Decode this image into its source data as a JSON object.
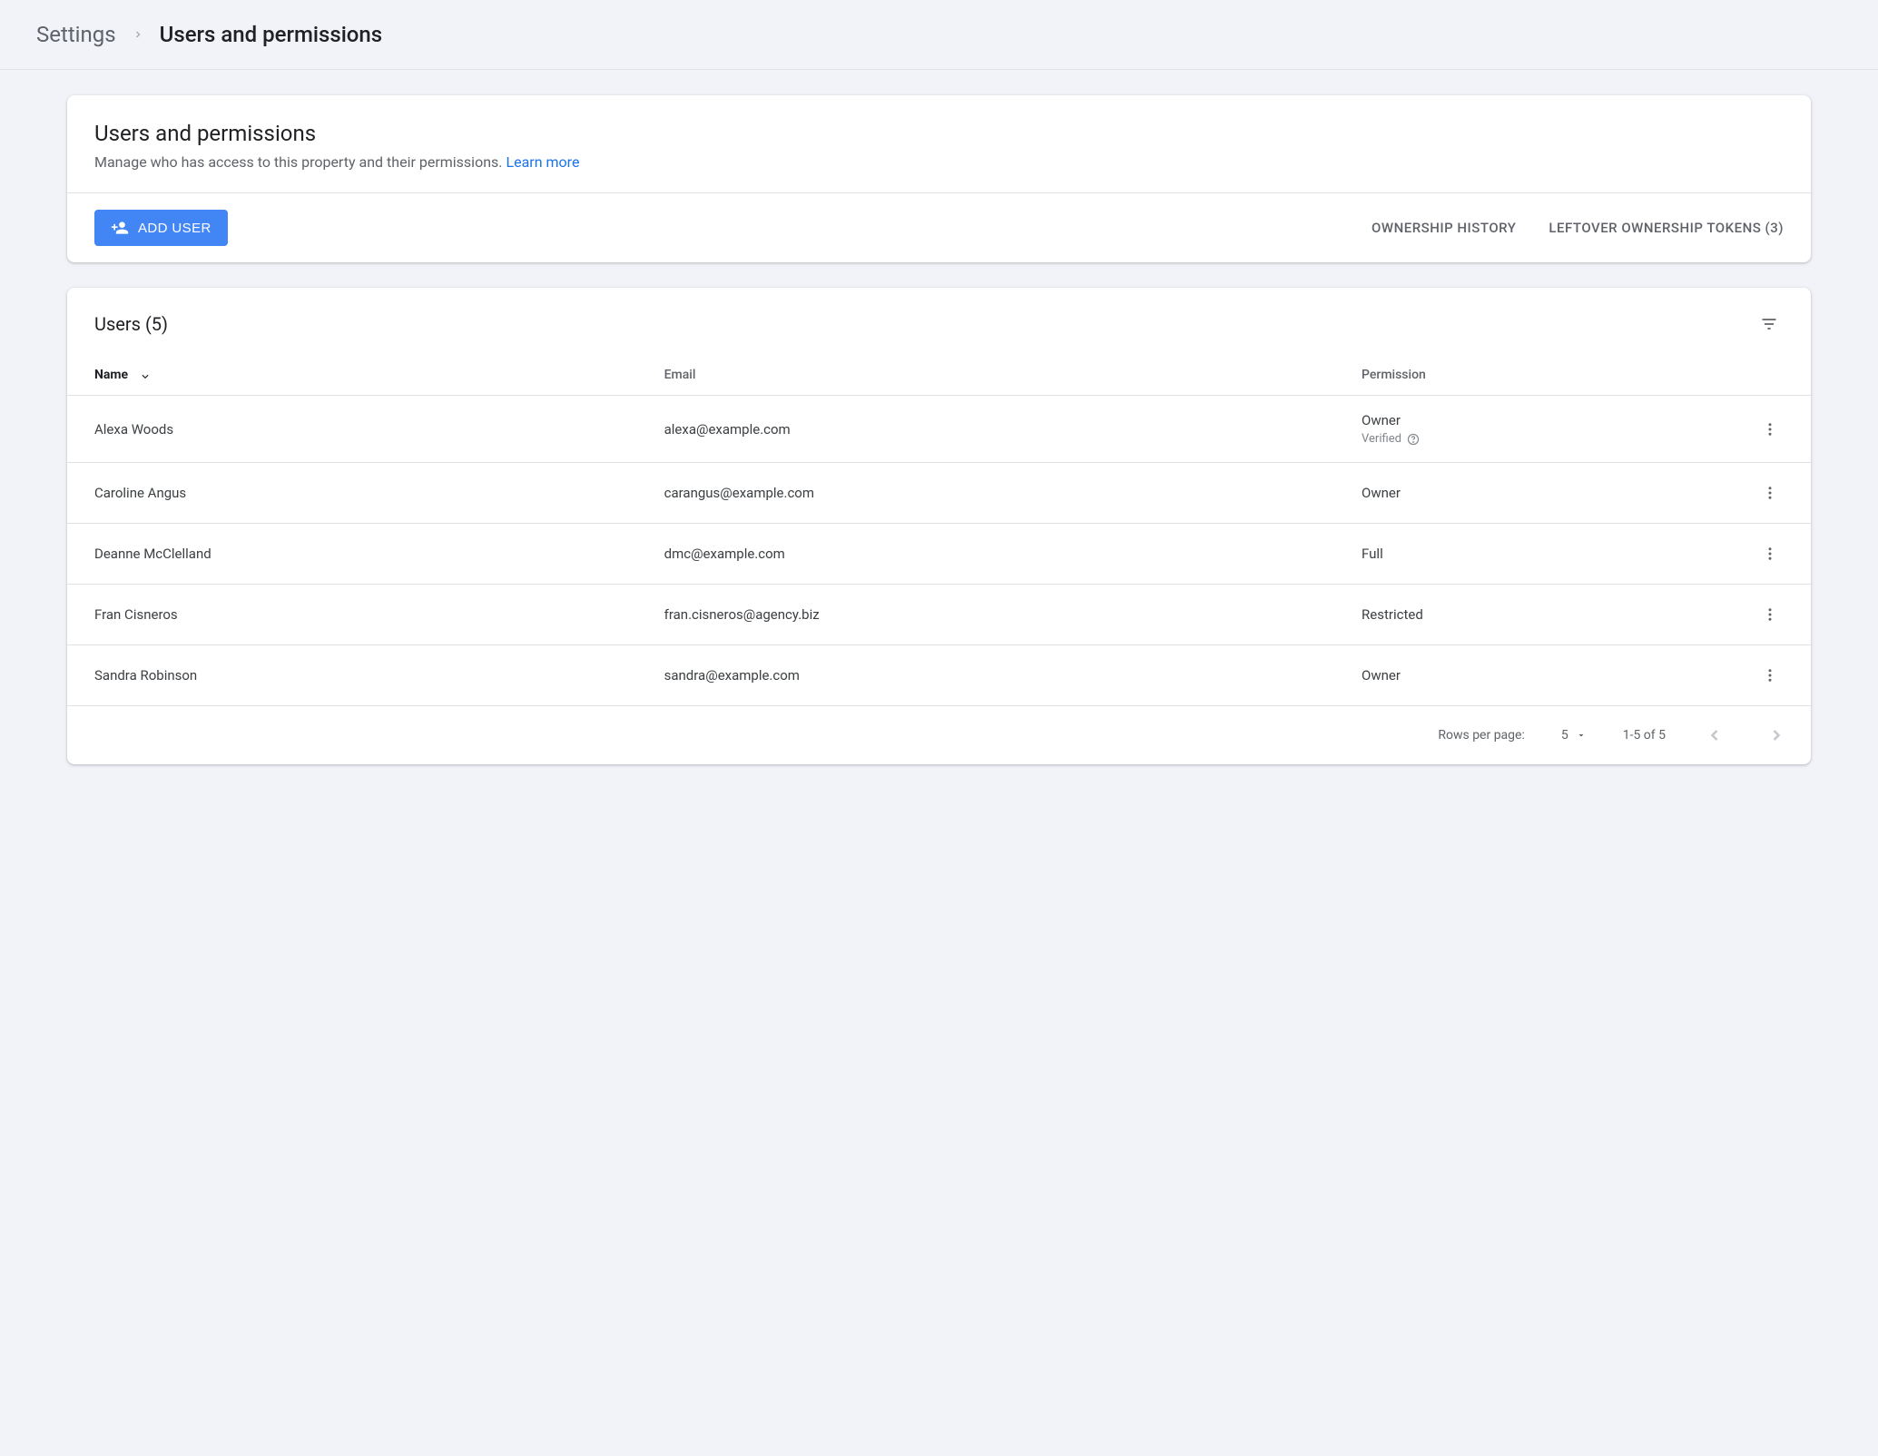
{
  "breadcrumb": {
    "root": "Settings",
    "current": "Users and permissions"
  },
  "header": {
    "title": "Users and permissions",
    "subtitle": "Manage who has access to this property and their permissions.",
    "learn_more": "Learn more"
  },
  "toolbar": {
    "add_user": "ADD USER",
    "ownership_history": "OWNERSHIP HISTORY",
    "leftover_tokens": "LEFTOVER OWNERSHIP TOKENS (3)"
  },
  "table": {
    "title": "Users (5)",
    "columns": {
      "name": "Name",
      "email": "Email",
      "permission": "Permission"
    },
    "verified_label": "Verified",
    "rows": [
      {
        "name": "Alexa Woods",
        "email": "alexa@example.com",
        "permission": "Owner",
        "verified": true
      },
      {
        "name": "Caroline Angus",
        "email": "carangus@example.com",
        "permission": "Owner",
        "verified": false
      },
      {
        "name": "Deanne McClelland",
        "email": "dmc@example.com",
        "permission": "Full",
        "verified": false
      },
      {
        "name": "Fran Cisneros",
        "email": "fran.cisneros@agency.biz",
        "permission": "Restricted",
        "verified": false
      },
      {
        "name": "Sandra Robinson",
        "email": "sandra@example.com",
        "permission": "Owner",
        "verified": false
      }
    ]
  },
  "pager": {
    "rows_label": "Rows per page:",
    "page_size": "5",
    "range": "1-5 of 5"
  }
}
